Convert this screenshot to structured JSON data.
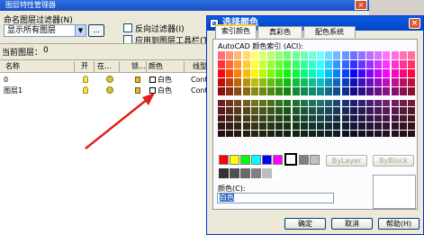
{
  "layer_manager": {
    "title": "图层特性管理器",
    "filter_label": "命名图层过滤器(N)",
    "filter_value": "显示所有图层",
    "filter_button": "...",
    "invert_filter_label": "反向过滤器(I)",
    "apply_toolbar_label": "应用到图层工具栏(T)",
    "current_layer_label": "当前图层：",
    "current_layer_value": "0",
    "columns": [
      "名称",
      "开",
      "在...",
      "锁...",
      "颜色",
      "线型"
    ],
    "rows": [
      {
        "name": "0",
        "color": "白色",
        "linetype": "Cont"
      },
      {
        "name": "图层1",
        "color": "白色",
        "linetype": "Cont"
      }
    ]
  },
  "color_dialog": {
    "title": "选择颜色",
    "tabs": [
      "索引颜色",
      "真彩色",
      "配色系统"
    ],
    "active_tab": 0,
    "aci_label": "AutoCAD 颜色索引 (ACI):",
    "bylayer_label": "ByLayer",
    "byblock_label": "ByBlock",
    "color_label": "颜色(C):",
    "color_value": "白色",
    "ok_label": "确定",
    "cancel_label": "取消",
    "help_label": "帮助(H)"
  },
  "colors": {
    "titlebar": "#1a4fc2",
    "arrow": "#e0201c",
    "selected": "#316ac5"
  }
}
